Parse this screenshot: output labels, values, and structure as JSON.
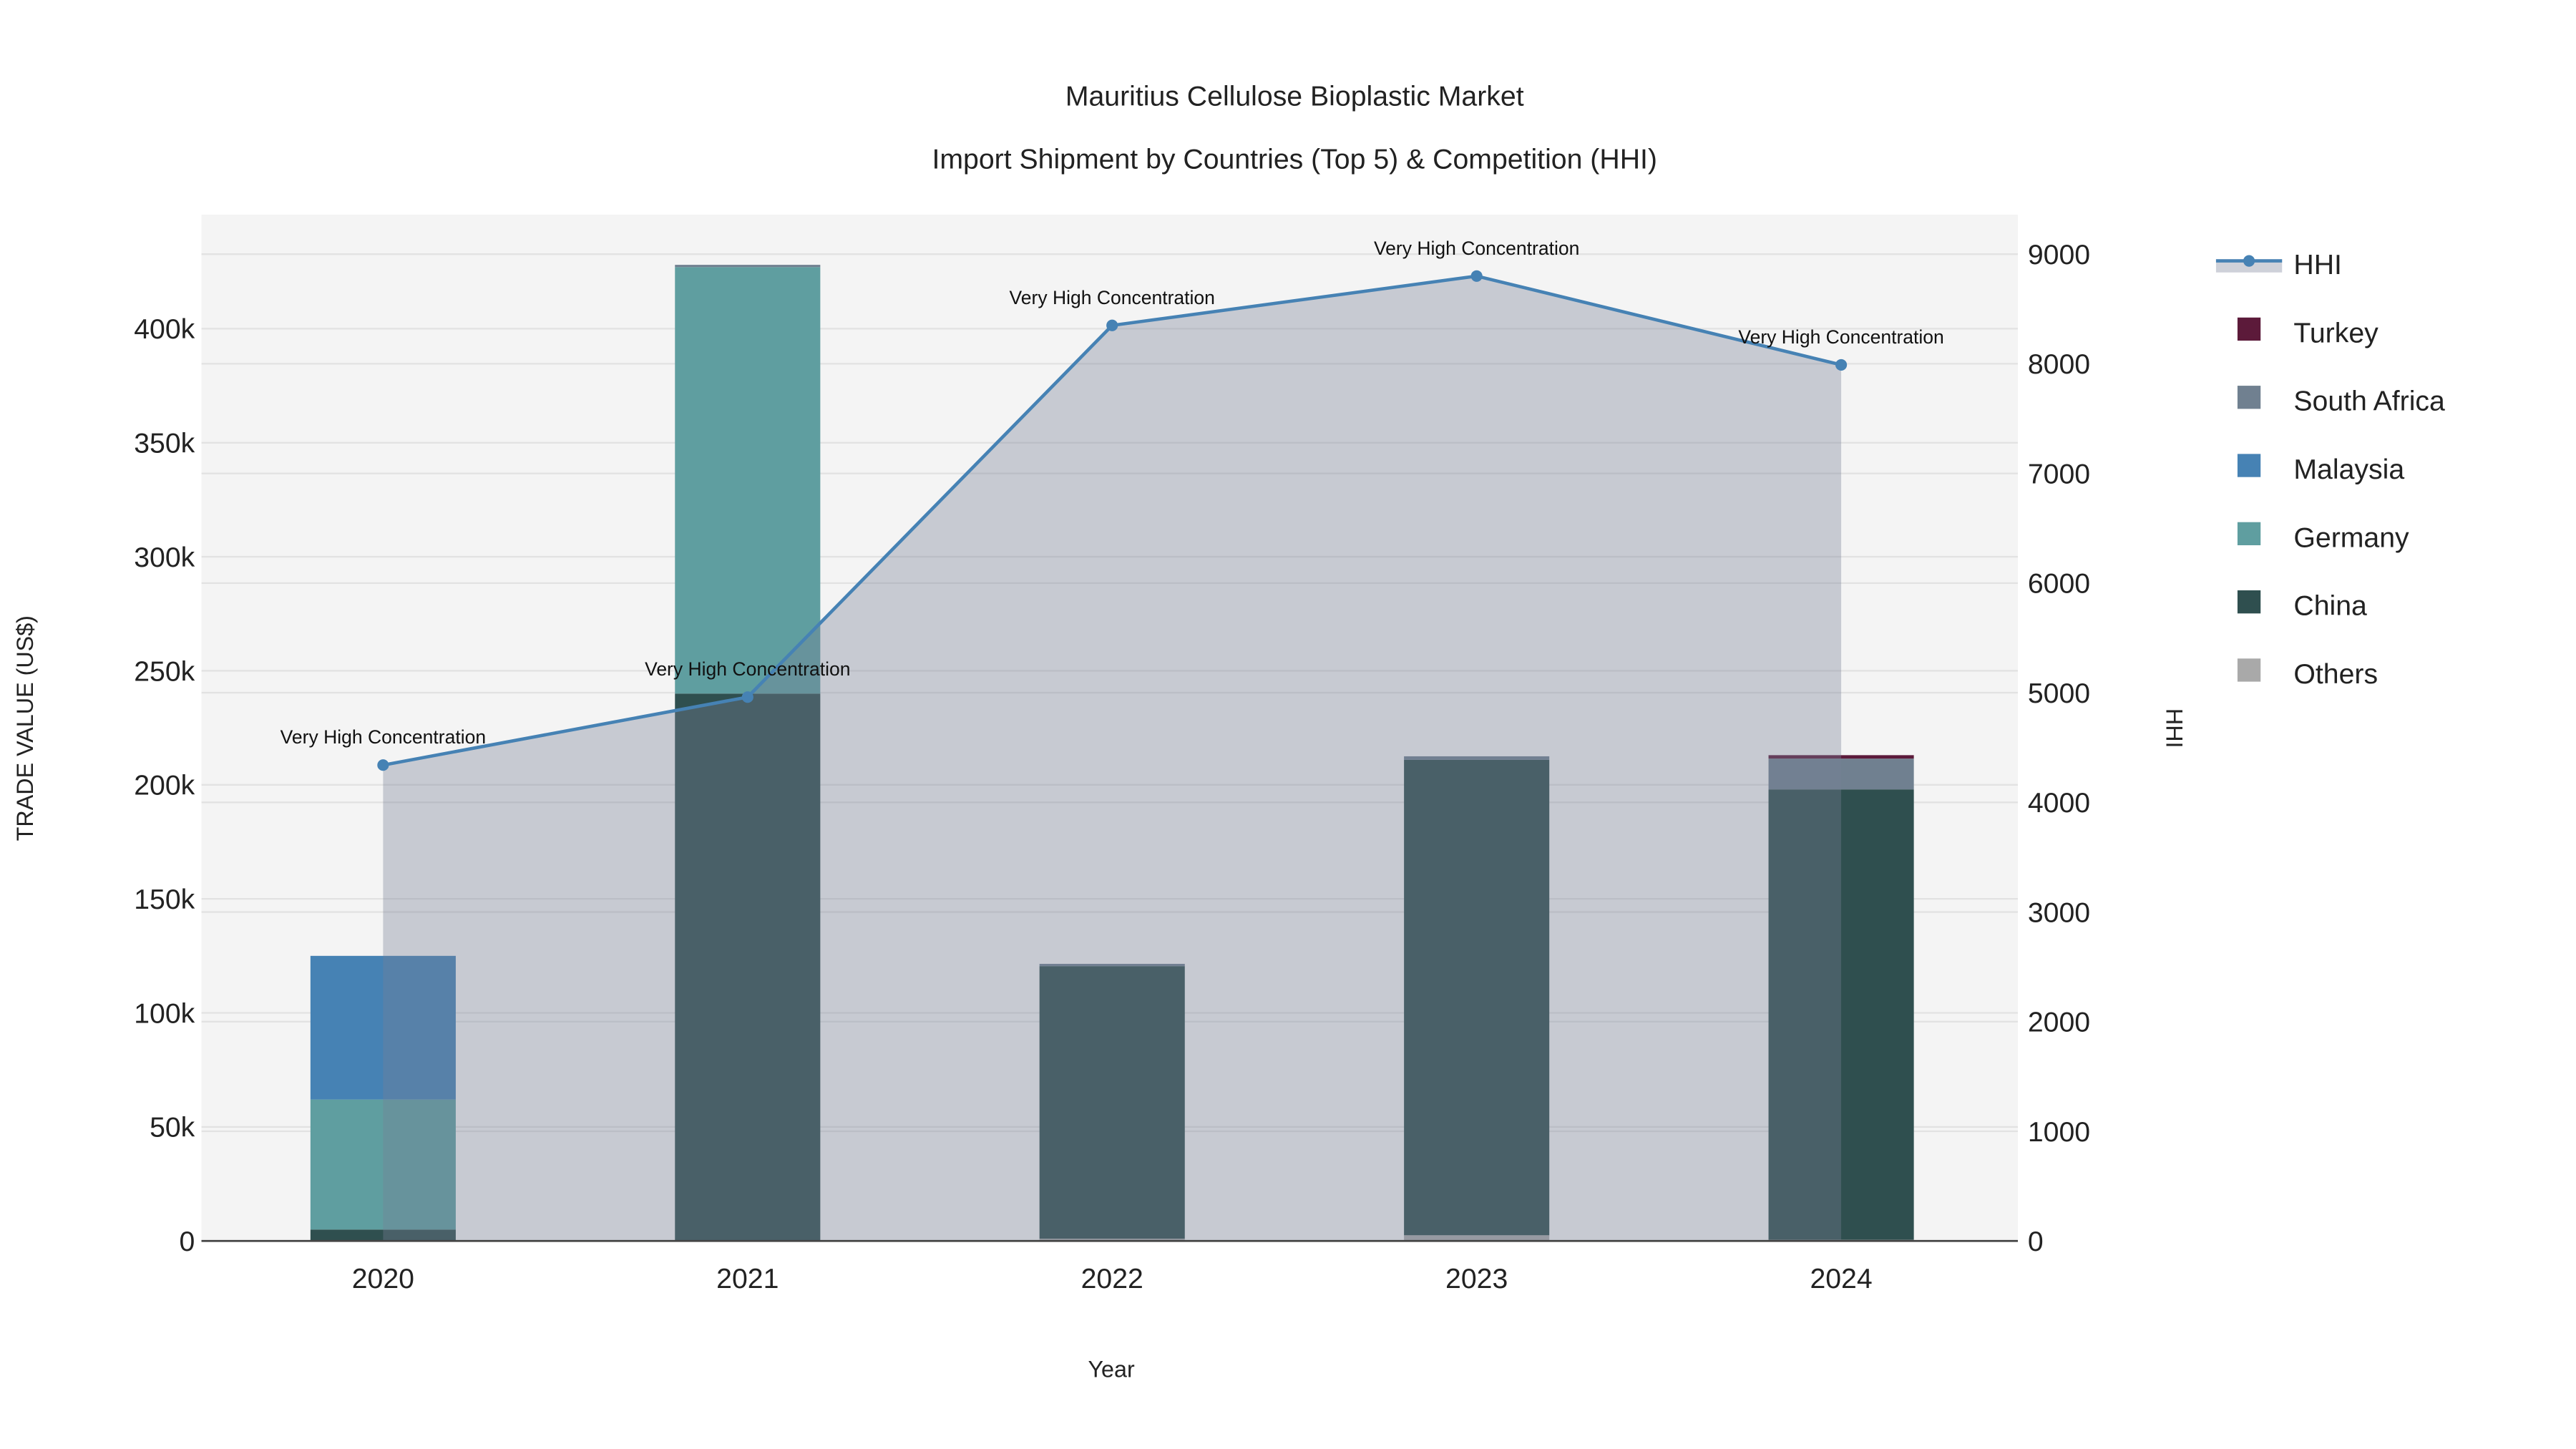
{
  "chart_data": {
    "type": "bar",
    "title_line1": "Mauritius Cellulose Bioplastic Market",
    "title_line2": "Import Shipment by Countries (Top 5) & Competition (HHI)",
    "xlabel": "Year",
    "ylabel": "TRADE VALUE (US$)",
    "y2label": "HHI",
    "categories": [
      "2020",
      "2021",
      "2022",
      "2023",
      "2024"
    ],
    "ylim": [
      0,
      450000
    ],
    "y2lim": [
      0,
      9360
    ],
    "yticks": [
      0,
      50000,
      100000,
      150000,
      200000,
      250000,
      300000,
      350000,
      400000
    ],
    "ytick_labels": [
      "0",
      "50k",
      "100k",
      "150k",
      "200k",
      "250k",
      "300k",
      "350k",
      "400k"
    ],
    "y2ticks": [
      0,
      1000,
      2000,
      3000,
      4000,
      5000,
      6000,
      7000,
      8000,
      9000
    ],
    "y2tick_labels": [
      "0",
      "1000",
      "2000",
      "3000",
      "4000",
      "5000",
      "6000",
      "7000",
      "8000",
      "9000"
    ],
    "barmode": "stack",
    "grid": true,
    "legend_placement": "right",
    "series": [
      {
        "name": "Others",
        "color": "#a9a9a9",
        "values": [
          0,
          0,
          1000,
          2500,
          500
        ]
      },
      {
        "name": "China",
        "color": "#2f4f4f",
        "values": [
          5000,
          240000,
          119500,
          208500,
          197500
        ]
      },
      {
        "name": "Germany",
        "color": "#5f9ea0",
        "values": [
          57000,
          187000,
          0,
          0,
          0
        ]
      },
      {
        "name": "Malaysia",
        "color": "#4682b4",
        "values": [
          63000,
          0,
          0,
          0,
          0
        ]
      },
      {
        "name": "South Africa",
        "color": "#708090",
        "values": [
          0,
          1000,
          1000,
          1500,
          13500
        ]
      },
      {
        "name": "Turkey",
        "color": "#5c1a3a",
        "values": [
          0,
          0,
          0,
          0,
          1500
        ]
      }
    ],
    "hhi": {
      "name": "HHI",
      "color": "#4682b4",
      "values": [
        4340,
        4960,
        8350,
        8800,
        7990
      ],
      "labels": [
        "Very High Concentration",
        "Very High Concentration",
        "Very High Concentration",
        "Very High Concentration",
        "Very High Concentration"
      ]
    },
    "legend_order": [
      "HHI",
      "Turkey",
      "South Africa",
      "Malaysia",
      "Germany",
      "China",
      "Others"
    ]
  }
}
